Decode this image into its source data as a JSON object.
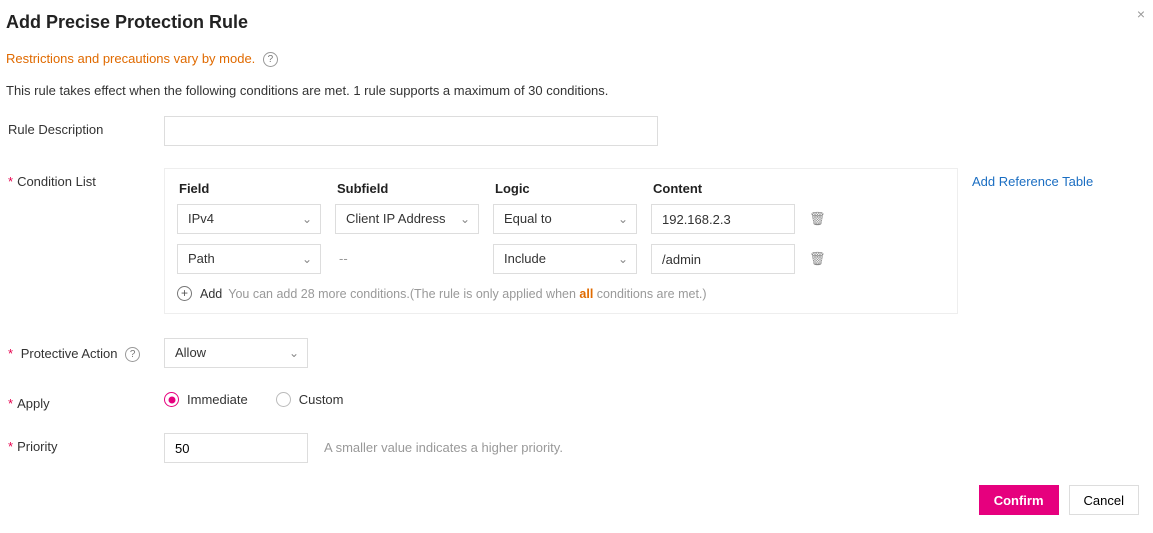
{
  "title": "Add Precise Protection Rule",
  "close_label": "×",
  "warning": "Restrictions and precautions vary by mode.",
  "description": "This rule takes effect when the following conditions are met. 1 rule supports a maximum of 30 conditions.",
  "labels": {
    "rule_description": "Rule Description",
    "condition_list": "Condition List",
    "protective_action": "Protective Action",
    "apply": "Apply",
    "priority": "Priority"
  },
  "rule_description_value": "",
  "condition_headers": {
    "field": "Field",
    "subfield": "Subfield",
    "logic": "Logic",
    "content": "Content"
  },
  "conditions": [
    {
      "field": "IPv4",
      "subfield": "Client IP Address",
      "subfield_is_select": true,
      "logic": "Equal to",
      "content": "192.168.2.3"
    },
    {
      "field": "Path",
      "subfield": "--",
      "subfield_is_select": false,
      "logic": "Include",
      "content": "/admin"
    }
  ],
  "add_link": {
    "label": "Add",
    "hint_1": "You can add 28 more conditions.(The rule is only applied when ",
    "all_word": "all",
    "hint_2": " conditions are met.)"
  },
  "reference_link": "Add Reference Table",
  "protective_action": {
    "value": "Allow"
  },
  "apply_options": {
    "immediate": "Immediate",
    "custom": "Custom",
    "selected": "immediate"
  },
  "priority": {
    "value": "50",
    "hint": "A smaller value indicates a higher priority."
  },
  "buttons": {
    "confirm": "Confirm",
    "cancel": "Cancel"
  },
  "icons": {
    "help": "?",
    "chevron": "⌄",
    "trash": "🗑",
    "plus": "+"
  }
}
